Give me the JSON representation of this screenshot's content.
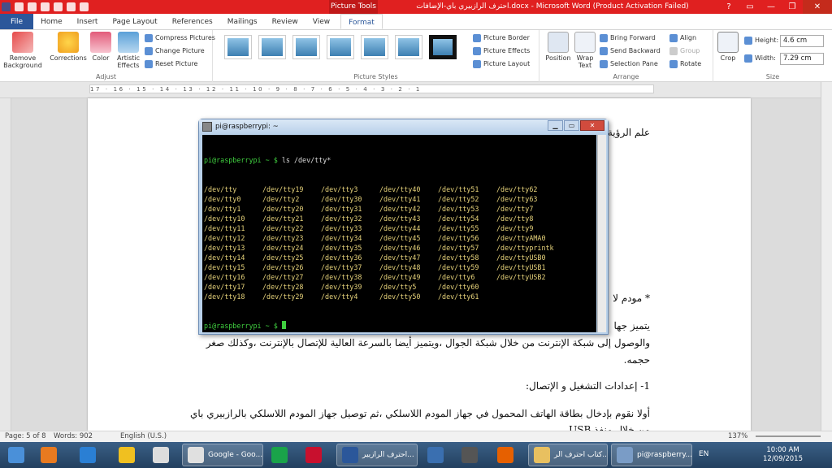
{
  "window": {
    "context_tab": "Picture Tools",
    "title": "احترف الرازبيري باي-الإضافات.docx - Microsoft Word (Product Activation Failed)",
    "controls": [
      "?",
      "▭",
      "—",
      "❐",
      "✕"
    ]
  },
  "tabs": [
    "File",
    "Home",
    "Insert",
    "Page Layout",
    "References",
    "Mailings",
    "Review",
    "View",
    "Format"
  ],
  "ribbon": {
    "adjust": {
      "label": "Adjust",
      "remove_background": "Remove Background",
      "corrections": "Corrections",
      "color": "Color",
      "artistic_effects": "Artistic Effects",
      "compress_pictures": "Compress Pictures",
      "change_picture": "Change Picture",
      "reset_picture": "Reset Picture"
    },
    "styles": {
      "label": "Picture Styles",
      "picture_border": "Picture Border",
      "picture_effects": "Picture Effects",
      "picture_layout": "Picture Layout"
    },
    "arrange": {
      "label": "Arrange",
      "position": "Position",
      "wrap_text": "Wrap Text",
      "bring_forward": "Bring Forward",
      "send_backward": "Send Backward",
      "selection_pane": "Selection Pane",
      "align": "Align",
      "group": "Group",
      "rotate": "Rotate"
    },
    "size": {
      "label": "Size",
      "crop": "Crop",
      "height_label": "Height:",
      "height_value": "4.6 cm",
      "width_label": "Width:",
      "width_value": "7.29 cm"
    }
  },
  "ruler_text": "17 · 16 · 15 · 14 · 13 · 12 · 11 · 10 · 9 · 8 · 7 · 6 · 5 · 4 · 3 · 2 · 1",
  "document": {
    "line_top": "علم الرؤية",
    "modem_heading": "* مودم لا",
    "para1_a": "يتميز جها",
    "para1_b": "والوصول إلى شبكة الإنترنت من خلال شبكة الجوال ،ويتميز أيضا بالسرعة العالية للإتصال بالإنترنت ،وكذلك صغر",
    "para1_c": "حجمه.",
    "section_heading": "1- إعدادات التشغيل و الإتصال:",
    "para2": "أولا نقوم بإدخال بطاقة الهاتف المحمول في جهاز المودم اللاسلكي ،ثم توصيل جهاز المودم اللاسلكي بالرازبيري باي",
    "para2_cut": "من خلال منفذ USB"
  },
  "terminal": {
    "title": "pi@raspberrypi: ~",
    "prompt": "pi@raspberrypi ~ $",
    "command": "ls /dev/tty*",
    "rows": [
      [
        "/dev/tty",
        "/dev/tty19",
        "/dev/tty3",
        "/dev/tty40",
        "/dev/tty51",
        "/dev/tty62"
      ],
      [
        "/dev/tty0",
        "/dev/tty2",
        "/dev/tty30",
        "/dev/tty41",
        "/dev/tty52",
        "/dev/tty63"
      ],
      [
        "/dev/tty1",
        "/dev/tty20",
        "/dev/tty31",
        "/dev/tty42",
        "/dev/tty53",
        "/dev/tty7"
      ],
      [
        "/dev/tty10",
        "/dev/tty21",
        "/dev/tty32",
        "/dev/tty43",
        "/dev/tty54",
        "/dev/tty8"
      ],
      [
        "/dev/tty11",
        "/dev/tty22",
        "/dev/tty33",
        "/dev/tty44",
        "/dev/tty55",
        "/dev/tty9"
      ],
      [
        "/dev/tty12",
        "/dev/tty23",
        "/dev/tty34",
        "/dev/tty45",
        "/dev/tty56",
        "/dev/ttyAMA0"
      ],
      [
        "/dev/tty13",
        "/dev/tty24",
        "/dev/tty35",
        "/dev/tty46",
        "/dev/tty57",
        "/dev/ttyprintk"
      ],
      [
        "/dev/tty14",
        "/dev/tty25",
        "/dev/tty36",
        "/dev/tty47",
        "/dev/tty58",
        "/dev/ttyUSB0"
      ],
      [
        "/dev/tty15",
        "/dev/tty26",
        "/dev/tty37",
        "/dev/tty48",
        "/dev/tty59",
        "/dev/ttyUSB1"
      ],
      [
        "/dev/tty16",
        "/dev/tty27",
        "/dev/tty38",
        "/dev/tty49",
        "/dev/tty6",
        "/dev/ttyUSB2"
      ],
      [
        "/dev/tty17",
        "/dev/tty28",
        "/dev/tty39",
        "/dev/tty5",
        "/dev/tty60",
        ""
      ],
      [
        "/dev/tty18",
        "/dev/tty29",
        "/dev/tty4",
        "/dev/tty50",
        "/dev/tty61",
        ""
      ]
    ]
  },
  "status": {
    "page": "Page: 5 of 8",
    "words": "Words: 902",
    "language": "English (U.S.)",
    "zoom": "137%"
  },
  "taskbar": {
    "items": [
      {
        "label": "",
        "icon": "windows-explorer-icon"
      },
      {
        "label": "",
        "icon": "media-player-icon"
      },
      {
        "label": "",
        "icon": "internet-explorer-icon"
      },
      {
        "label": "",
        "icon": "paint-icon"
      },
      {
        "label": "",
        "icon": "notepad-icon"
      },
      {
        "label": "Google - Goo...",
        "icon": "chrome-icon"
      },
      {
        "label": "",
        "icon": "arrow-app-icon"
      },
      {
        "label": "",
        "icon": "acrobat-icon"
      },
      {
        "label": "احترف الرازبير...",
        "icon": "word-icon"
      },
      {
        "label": "",
        "icon": "app-337-icon"
      },
      {
        "label": "",
        "icon": "mp-icon"
      },
      {
        "label": "",
        "icon": "firefox-icon"
      },
      {
        "label": "كتاب احترف الر...",
        "icon": "folder-icon"
      },
      {
        "label": "pi@raspberry...",
        "icon": "putty-icon"
      }
    ],
    "lang": "EN",
    "time": "10:00 AM",
    "date": "12/09/2015"
  },
  "colors": {
    "title_bar": "#e02020",
    "accent": "#2b579a",
    "terminal_text": "#e6d27a",
    "terminal_prompt": "#3fcf3f"
  }
}
